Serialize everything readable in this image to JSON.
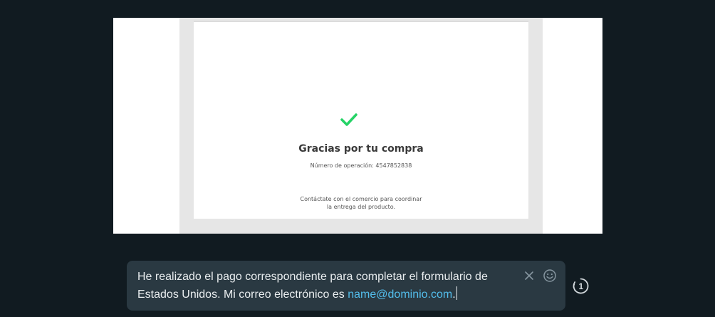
{
  "preview": {
    "receipt": {
      "check_icon": "check-icon",
      "check_color": "#25d366",
      "title": "Gracias por tu compra",
      "operation_number": "Número de operación: 4547852838",
      "contact_line1": "Contáctate con el comercio para coordinar",
      "contact_line2": "la entrega del producto."
    }
  },
  "composer": {
    "caption_text": "He realizado el pago correspondiente para completar el formulario de Estados Unidos. Mi correo electrónico es ",
    "caption_link": "name@dominio.com",
    "caption_end": ".",
    "clear_icon": "close-icon",
    "emoji_icon": "emoji-icon"
  },
  "view_once": {
    "icon": "view-once-icon",
    "label": "1"
  },
  "colors": {
    "background": "#111b21",
    "composer_bg": "#2a3942",
    "text": "#e9edef",
    "link": "#53bdeb",
    "icon": "#8696a0"
  }
}
